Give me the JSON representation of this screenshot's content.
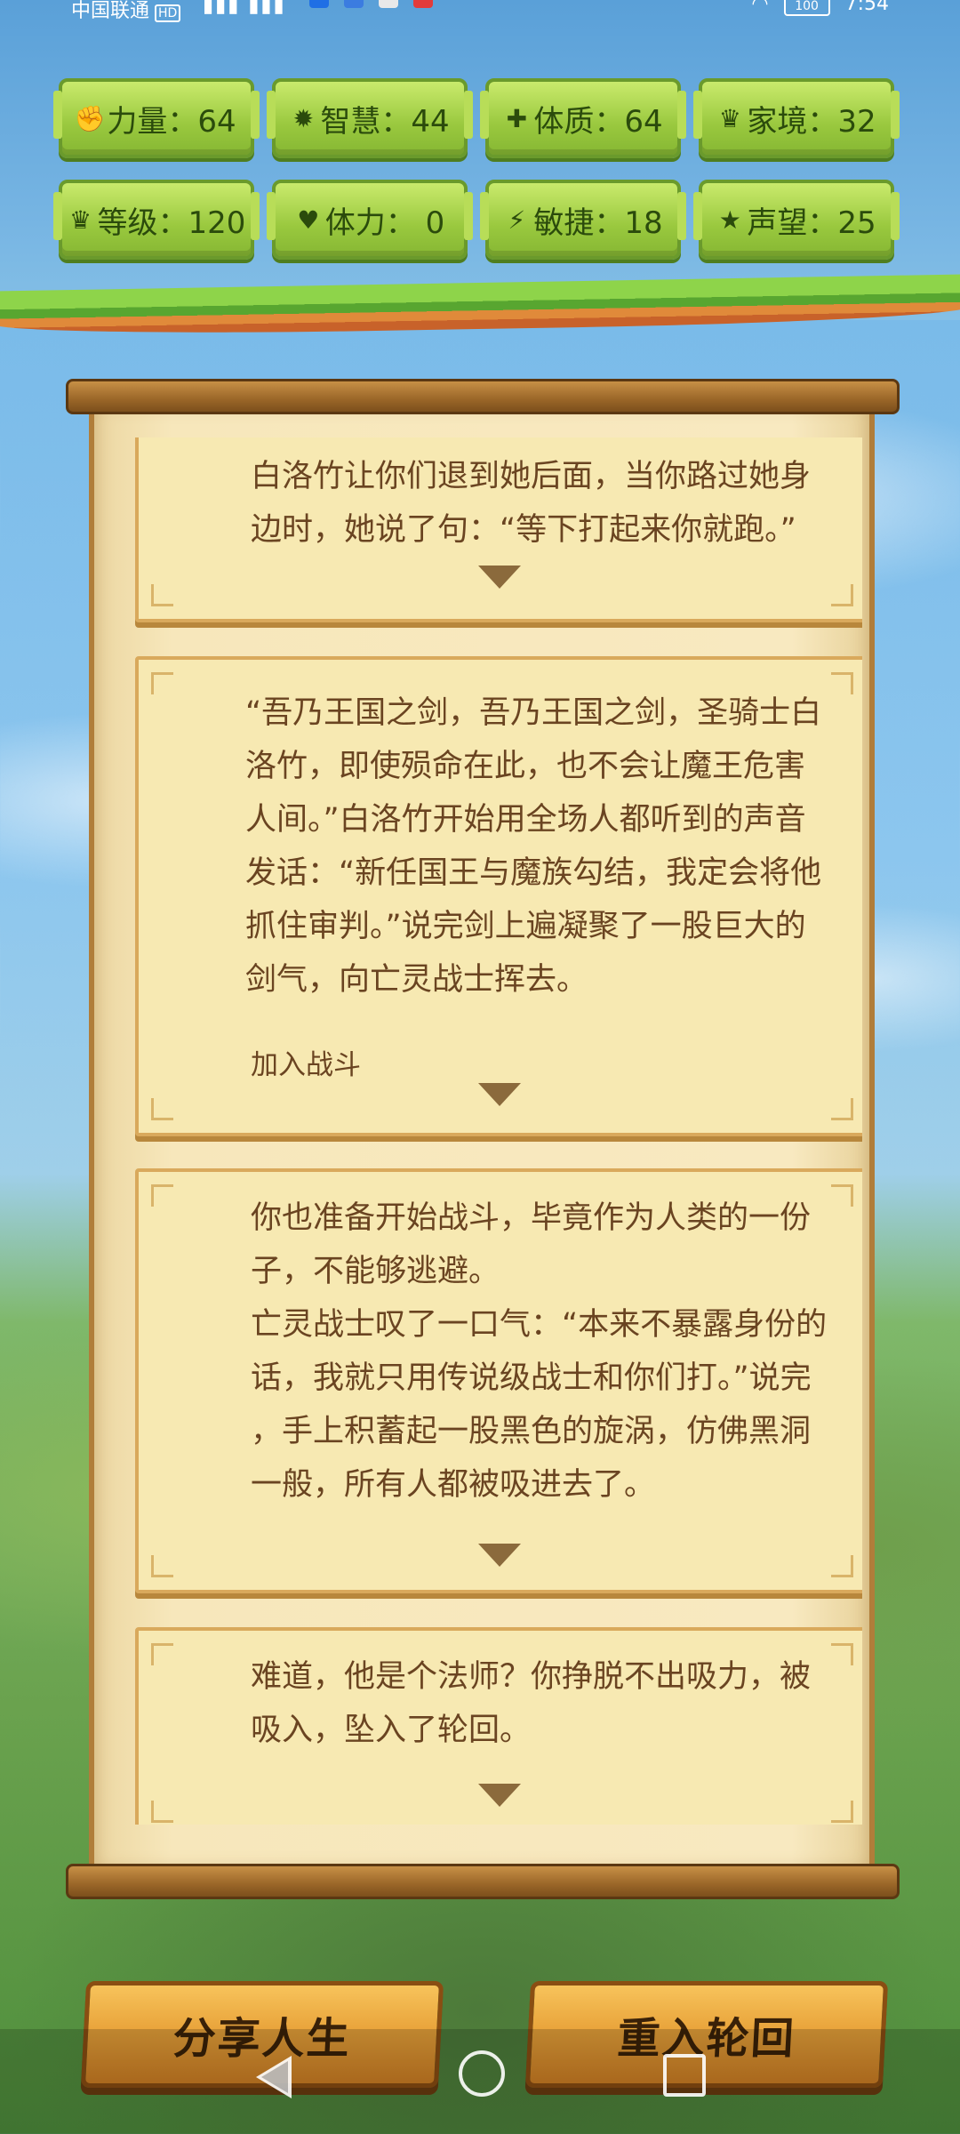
{
  "status_bar": {
    "carrier": "中国联通",
    "carrier_badge": "HD",
    "battery": "100",
    "time": "7:54"
  },
  "stats": [
    {
      "icon": "fist-icon",
      "glyph": "✊",
      "label": "力量：64"
    },
    {
      "icon": "bulb-icon",
      "glyph": "✹",
      "label": "智慧：44"
    },
    {
      "icon": "cross-circle-icon",
      "glyph": "✚",
      "label": "体质：64"
    },
    {
      "icon": "laurel-icon",
      "glyph": "♛",
      "label": "家境：32"
    },
    {
      "icon": "crown-icon",
      "glyph": "♛",
      "label": "等级：120"
    },
    {
      "icon": "heart-icon",
      "glyph": "♥",
      "label": "体力： 0"
    },
    {
      "icon": "lightning-icon",
      "glyph": "⚡",
      "label": "敏捷：18"
    },
    {
      "icon": "star-icon",
      "glyph": "★",
      "label": "声望：25"
    }
  ],
  "story": {
    "cards": [
      {
        "text": "白洛竹让你们退到她后面，当你路过她身\n边时，她说了句：“等下打起来你就跑。”"
      },
      {
        "text": "“吾乃王国之剑，吾乃王国之剑，圣骑士白\n洛竹，即使殒命在此，也不会让魔王危害\n人间。”白洛竹开始用全场人都听到的声音\n发话：“新任国王与魔族勾结，我定会将他\n抓住审判。”说完剑上遍凝聚了一股巨大的\n剑气，向亡灵战士挥去。",
        "choice": "加入战斗"
      },
      {
        "text": "你也准备开始战斗，毕竟作为人类的一份\n子，不能够逃避。\n亡灵战士叹了一口气：“本来不暴露身份的\n话，我就只用传说级战士和你们打。”说完\n，手上积蓄起一股黑色的旋涡，仿佛黑洞\n一般，所有人都被吸进去了。"
      },
      {
        "text": "难道，他是个法师？你挣脱不出吸力，被\n吸入，坠入了轮回。"
      }
    ]
  },
  "buttons": {
    "share": "分享人生",
    "restart": "重入轮回"
  }
}
